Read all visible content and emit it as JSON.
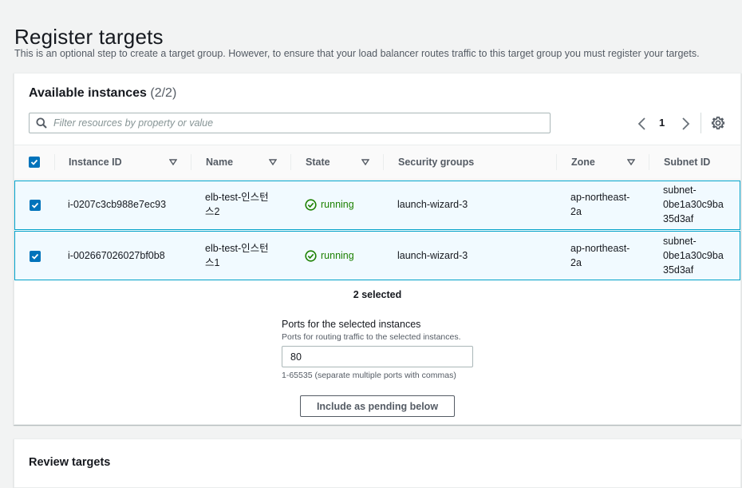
{
  "page": {
    "title": "Register targets",
    "description": "This is an optional step to create a target group. However, to ensure that your load balancer routes traffic to this target group you must register your targets."
  },
  "available_instances": {
    "title": "Available instances",
    "count": "(2/2)",
    "search_placeholder": "Filter resources by property or value",
    "current_page": "1",
    "columns": [
      "Instance ID",
      "Name",
      "State",
      "Security groups",
      "Zone",
      "Subnet ID"
    ],
    "rows": [
      {
        "instance_id": "i-0207c3cb988e7ec93",
        "name_line1": "elb-test-인스턴",
        "name_line2": "스2",
        "state": "running",
        "security_groups": "launch-wizard-3",
        "zone_line1": "ap-northeast-",
        "zone_line2": "2a",
        "subnet_line1": "subnet-",
        "subnet_line2": "0be1a30c9ba",
        "subnet_line3": "35d3af"
      },
      {
        "instance_id": "i-002667026027bf0b8",
        "name_line1": "elb-test-인스턴",
        "name_line2": "스1",
        "state": "running",
        "security_groups": "launch-wizard-3",
        "zone_line1": "ap-northeast-",
        "zone_line2": "2a",
        "subnet_line1": "subnet-",
        "subnet_line2": "0be1a30c9ba",
        "subnet_line3": "35d3af"
      }
    ],
    "selected_text": "2 selected",
    "ports_label": "Ports for the selected instances",
    "ports_description": "Ports for routing traffic to the selected instances.",
    "ports_value": "80",
    "ports_hint": "1-65535 (separate multiple ports with commas)",
    "include_button": "Include as pending below"
  },
  "review_targets": {
    "title": "Review targets"
  },
  "icons": {
    "search": "search-icon",
    "prev": "chevron-left-icon",
    "next": "chevron-right-icon",
    "settings": "gear-icon",
    "sort": "caret-down-icon",
    "status": "check-circle-icon",
    "checkbox": "checkmark-icon"
  },
  "colors": {
    "accent": "#0073bb",
    "selected_row_bg": "#f1faff",
    "selected_row_border": "#00a1c9",
    "running": "#1d8102"
  }
}
